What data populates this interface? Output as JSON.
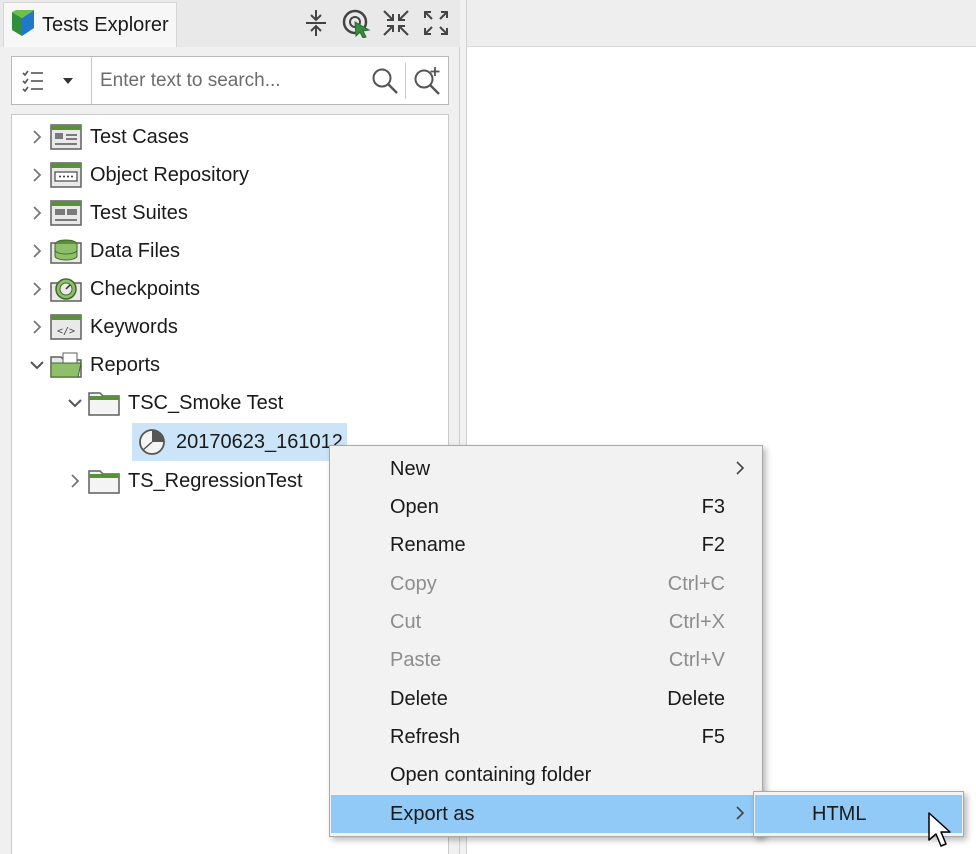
{
  "panel": {
    "tab_title": "Tests Explorer",
    "tools": [
      "collapse-all-icon",
      "link-target-icon",
      "shrink-icon",
      "maximize-icon"
    ]
  },
  "search": {
    "placeholder": "Enter text to search...",
    "value": ""
  },
  "tree": {
    "nodes": [
      {
        "label": "Test Cases",
        "icon": "test-cases-icon",
        "expanded": false
      },
      {
        "label": "Object Repository",
        "icon": "object-repository-icon",
        "expanded": false
      },
      {
        "label": "Test Suites",
        "icon": "test-suites-icon",
        "expanded": false
      },
      {
        "label": "Data Files",
        "icon": "data-files-icon",
        "expanded": false
      },
      {
        "label": "Checkpoints",
        "icon": "checkpoints-icon",
        "expanded": false
      },
      {
        "label": "Keywords",
        "icon": "keywords-icon",
        "expanded": false
      },
      {
        "label": "Reports",
        "icon": "reports-folder-icon",
        "expanded": true
      },
      {
        "label": "TSC_Smoke Test",
        "icon": "folder-icon",
        "expanded": true
      },
      {
        "label": "20170623_161012",
        "icon": "report-icon",
        "selected": true
      },
      {
        "label": "TS_RegressionTest",
        "icon": "folder-icon",
        "expanded": false
      }
    ]
  },
  "context_menu": {
    "items": [
      {
        "label": "New",
        "shortcut": "",
        "submenu": true,
        "disabled": false
      },
      {
        "label": "Open",
        "shortcut": "F3",
        "submenu": false,
        "disabled": false
      },
      {
        "label": "Rename",
        "shortcut": "F2",
        "submenu": false,
        "disabled": false
      },
      {
        "label": "Copy",
        "shortcut": "Ctrl+C",
        "submenu": false,
        "disabled": true
      },
      {
        "label": "Cut",
        "shortcut": "Ctrl+X",
        "submenu": false,
        "disabled": true
      },
      {
        "label": "Paste",
        "shortcut": "Ctrl+V",
        "submenu": false,
        "disabled": true
      },
      {
        "label": "Delete",
        "shortcut": "Delete",
        "submenu": false,
        "disabled": false
      },
      {
        "label": "Refresh",
        "shortcut": "F5",
        "submenu": false,
        "disabled": false
      },
      {
        "label": "Open containing folder",
        "shortcut": "",
        "submenu": false,
        "disabled": false
      },
      {
        "label": "Export as",
        "shortcut": "",
        "submenu": true,
        "disabled": false,
        "highlighted": true
      }
    ]
  },
  "export_submenu": {
    "items": [
      {
        "label": "HTML",
        "highlighted": true
      }
    ]
  },
  "colors": {
    "highlight": "#91c9f7",
    "selection": "#cce4f7",
    "icon_green": "#5a8f3c",
    "disabled_text": "#8d8d8d"
  }
}
